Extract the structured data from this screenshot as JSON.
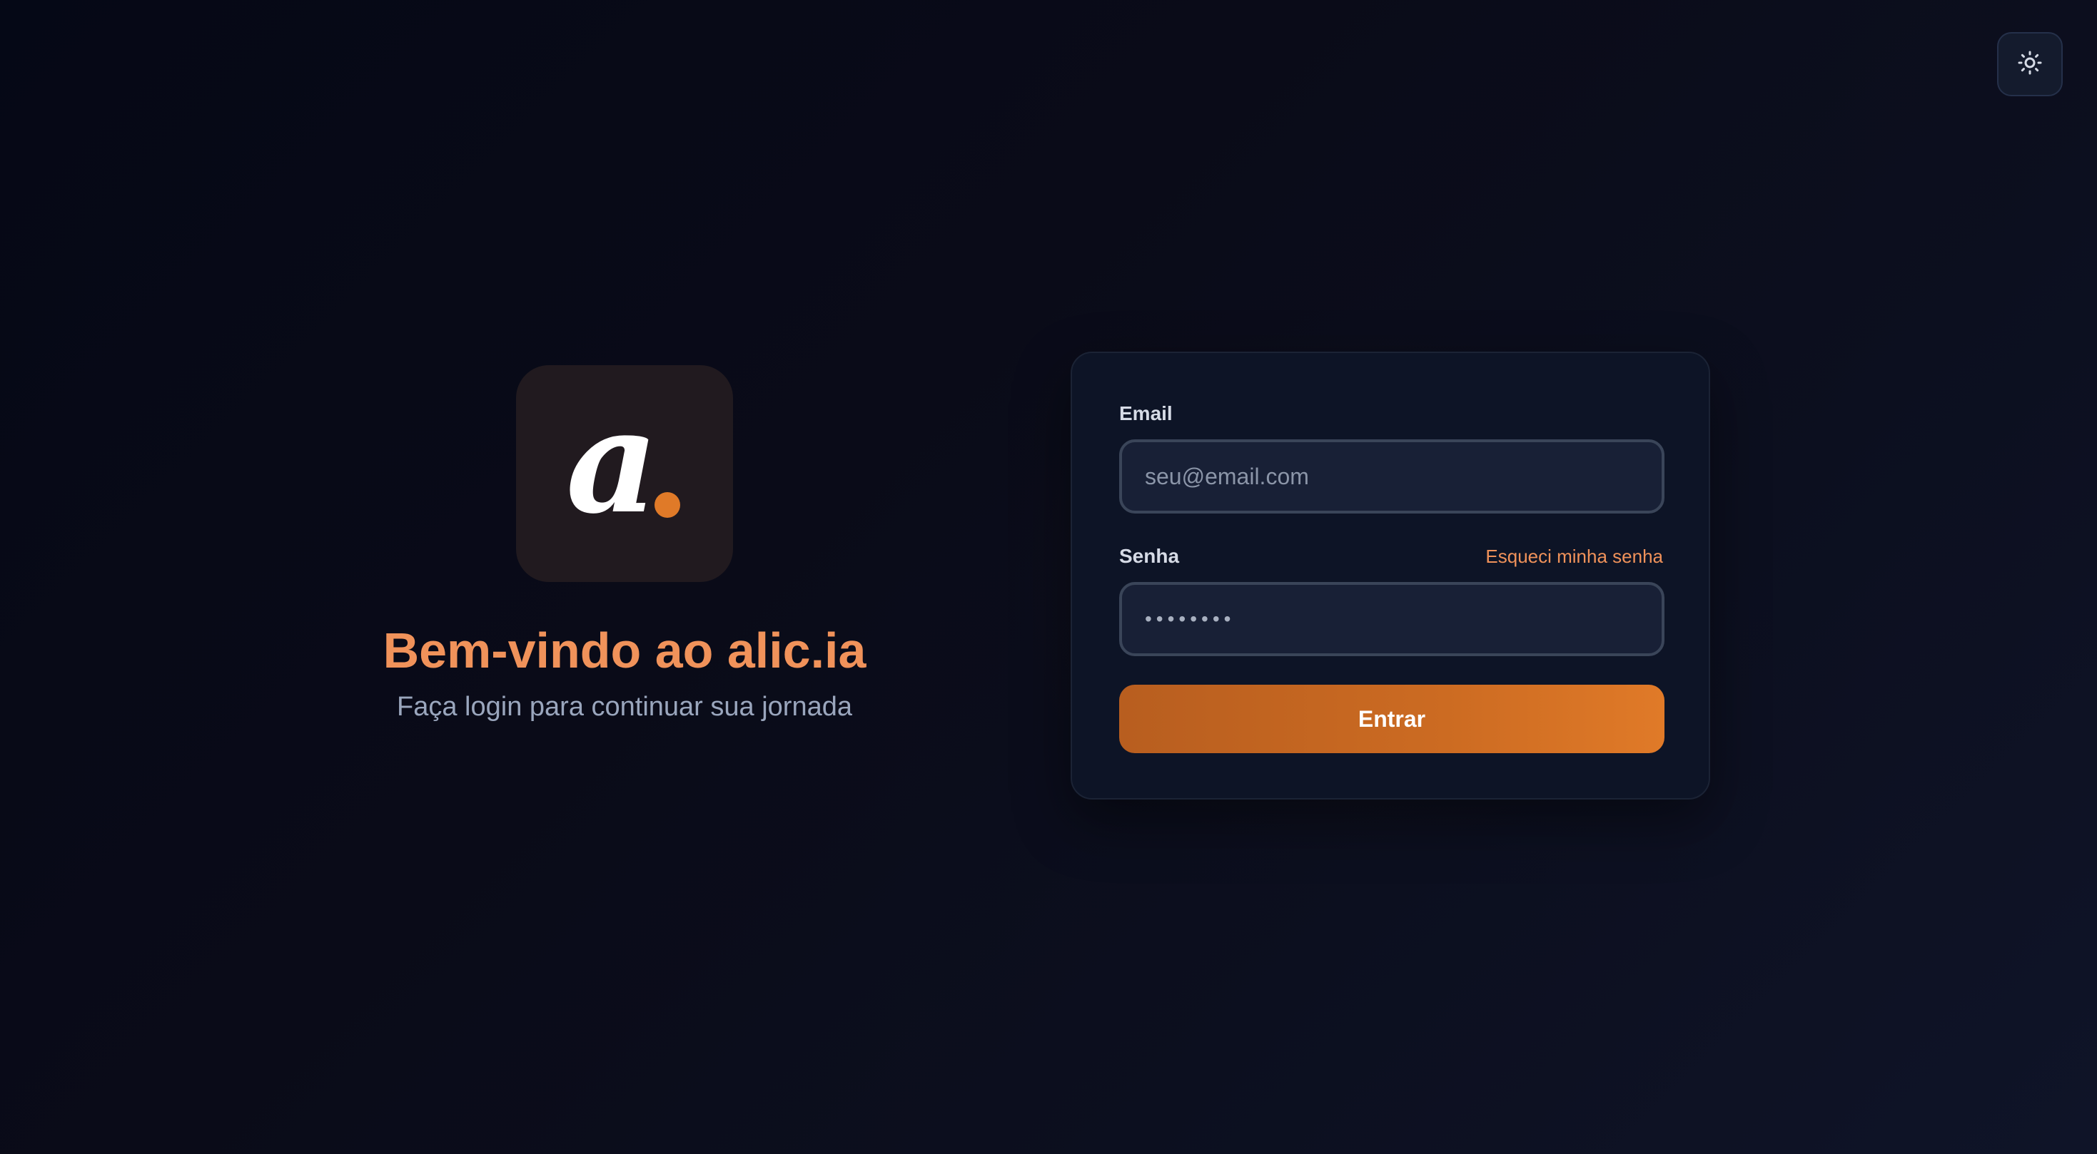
{
  "theme_toggle": {
    "icon": "sun-icon"
  },
  "brand": {
    "logo_letter": "a",
    "title": "Bem-vindo ao alic.ia",
    "subtitle": "Faça login para continuar sua jornada"
  },
  "login_form": {
    "email_label": "Email",
    "email_placeholder": "seu@email.com",
    "password_label": "Senha",
    "password_value": "••••••••",
    "forgot_link": "Esqueci minha senha",
    "submit_label": "Entrar"
  },
  "colors": {
    "accent": "#f0925a",
    "button": "#cc6b22",
    "background": "#0a0b18",
    "card": "#0d1426"
  }
}
